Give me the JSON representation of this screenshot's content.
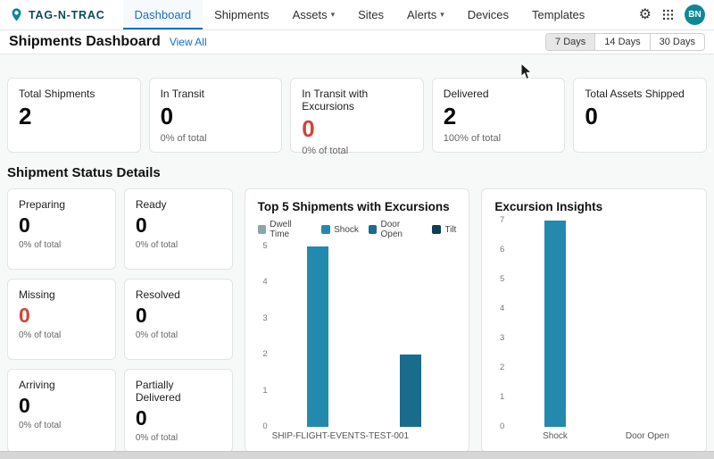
{
  "colors": {
    "accent_blue": "#1b6ec2",
    "brand_teal": "#0e8796",
    "status_red": "#cf453c",
    "bar_teal": "#2389ad"
  },
  "icons": {
    "gear": "⚙",
    "chevron_down": "▾"
  },
  "nav": {
    "brand": "TAG-N-TRAC",
    "items": [
      {
        "label": "Dashboard"
      },
      {
        "label": "Shipments"
      },
      {
        "label": "Assets"
      },
      {
        "label": "Sites"
      },
      {
        "label": "Alerts"
      },
      {
        "label": "Devices"
      },
      {
        "label": "Templates"
      }
    ],
    "avatar_initials": "BN"
  },
  "header": {
    "title": "Shipments Dashboard",
    "view_all_label": "View All",
    "ranges": [
      {
        "label": "7 Days",
        "active": true
      },
      {
        "label": "14 Days",
        "active": false
      },
      {
        "label": "30 Days",
        "active": false
      }
    ]
  },
  "summary_cards": [
    {
      "label": "Total Shipments",
      "value": "2"
    },
    {
      "label": "In Transit",
      "value": "0",
      "sub": "0% of total"
    },
    {
      "label": "In Transit with Excursions",
      "value": "0",
      "sub": "0% of total"
    },
    {
      "label": "Delivered",
      "value": "2",
      "sub": "100% of total"
    },
    {
      "label": "Total Assets Shipped",
      "value": "0"
    }
  ],
  "status_section": {
    "title": "Shipment Status Details",
    "cards": [
      {
        "label": "Preparing",
        "value": "0",
        "sub": "0% of total"
      },
      {
        "label": "Ready",
        "value": "0",
        "sub": "0% of total"
      },
      {
        "label": "Missing",
        "value": "0",
        "sub": "0% of total"
      },
      {
        "label": "Resolved",
        "value": "0",
        "sub": "0% of total"
      },
      {
        "label": "Arriving",
        "value": "0",
        "sub": "0% of total"
      },
      {
        "label": "Partially Delivered",
        "value": "0",
        "sub": "0% of total"
      }
    ]
  },
  "chart_data": [
    {
      "type": "bar",
      "title": "Top 5 Shipments with Excursions",
      "categories": [
        "SHIP-FLIGHT-EVENTS-TEST-001"
      ],
      "series": [
        {
          "name": "Dwell Time",
          "color": "#8da3ad",
          "values": [
            0
          ]
        },
        {
          "name": "Shock",
          "color": "#2389ad",
          "values": [
            5
          ]
        },
        {
          "name": "Door Open",
          "color": "#1a6c8d",
          "values": [
            2
          ]
        },
        {
          "name": "Tilt",
          "color": "#103e54",
          "values": [
            0
          ]
        }
      ],
      "ylim": [
        0,
        5
      ],
      "yticks": [
        0,
        1,
        2,
        3,
        4,
        5
      ],
      "legend_position": "top",
      "grid": false
    },
    {
      "type": "bar",
      "title": "Excursion Insights",
      "categories": [
        "Shock",
        "Door Open"
      ],
      "values": [
        7,
        0
      ],
      "color": "#2389ad",
      "ylim": [
        0,
        7
      ],
      "yticks": [
        0,
        1,
        2,
        3,
        4,
        5,
        6,
        7
      ],
      "grid": false
    }
  ]
}
